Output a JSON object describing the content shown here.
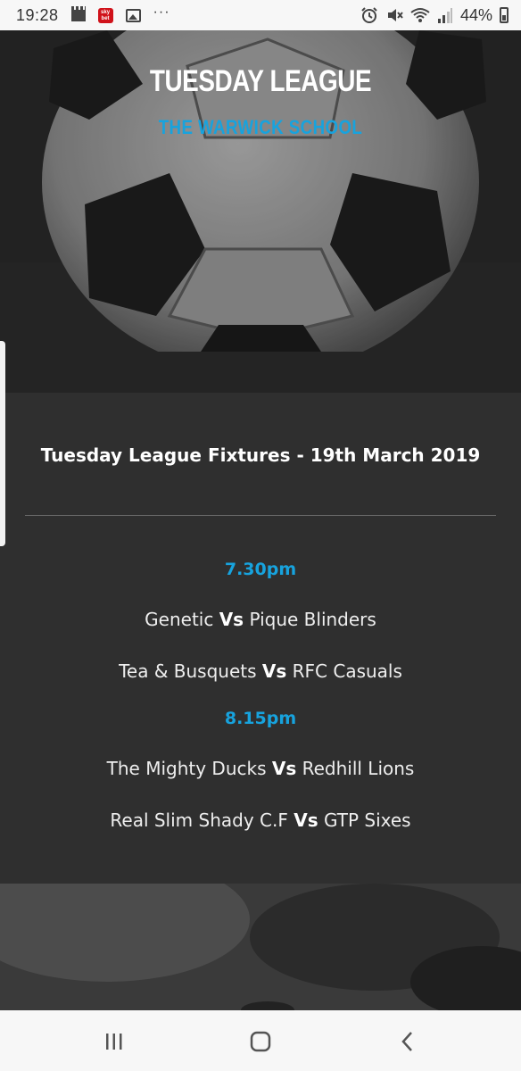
{
  "status_bar": {
    "time": "19:28",
    "notification_icons": [
      "clapperboard-icon",
      "skybet-icon",
      "gallery-icon"
    ],
    "more": "···",
    "battery": "44%",
    "system_icons": [
      "alarm-icon",
      "mute-icon",
      "wifi-icon",
      "signal-icon",
      "battery-icon"
    ]
  },
  "hero": {
    "title": "TUESDAY LEAGUE",
    "subtitle": "THE WARWICK SCHOOL"
  },
  "fixtures": {
    "heading": "Tuesday League Fixtures - 19th March 2019",
    "vs_label": "Vs",
    "slots": [
      {
        "time": "7.30pm",
        "matches": [
          {
            "home": "Genetic",
            "away": "Pique Blinders"
          },
          {
            "home": "Tea & Busquets",
            "away": "RFC Casuals"
          }
        ]
      },
      {
        "time": "8.15pm",
        "matches": [
          {
            "home": "The Mighty Ducks",
            "away": "Redhill Lions"
          },
          {
            "home": "Real Slim Shady C.F",
            "away": "GTP Sixes"
          }
        ]
      }
    ]
  },
  "nav_bar": {
    "buttons": [
      "recent-apps-icon",
      "home-icon",
      "back-icon"
    ]
  },
  "colors": {
    "accent": "#17a3de",
    "panel_background": "#2f2f2f",
    "status_bar_background": "#f7f7f7"
  }
}
